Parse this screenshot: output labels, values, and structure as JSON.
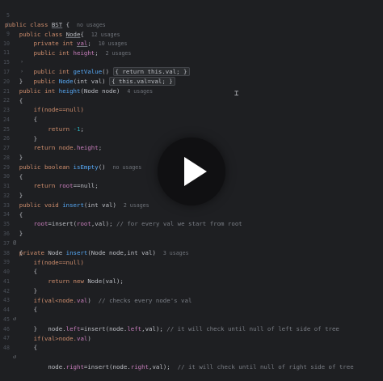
{
  "editor": {
    "hints": {
      "no_usages": "no usages",
      "u12": "12 usages",
      "u10": "10 usages",
      "u2": "2 usages",
      "u4": "4 usages",
      "u3": "3 usages"
    },
    "line_numbers": [
      "5",
      "6",
      "9",
      "10",
      "11",
      "15",
      "17",
      "20",
      "21",
      "22",
      "23",
      "24",
      "25",
      "26",
      "27",
      "28",
      "29",
      "30",
      "31",
      "32",
      "33",
      "34",
      "35",
      "36",
      "37",
      "38",
      "39",
      "40",
      "41",
      "42",
      "43",
      "44",
      "45",
      "46",
      "47",
      "48"
    ],
    "text": {
      "l5_a": "public class ",
      "l5_b": "BST",
      "l5_c": " {",
      "l6_a": "    public class ",
      "l6_b": "Node",
      "l6_c": "{",
      "l9_a": "        private int ",
      "l9_b": "val",
      "l9_c": ";",
      "l10_a": "        public int ",
      "l10_b": "height",
      "l10_c": ";",
      "l11_a": "        public int ",
      "l11_b": "getValue",
      "l11_c": "() ",
      "l11_fold": "{ return this.val; }",
      "l15_a": "        public ",
      "l15_b": "Node",
      "l15_c": "(int val) ",
      "l15_fold": "{ this.val=val; }",
      "l17": "    }",
      "l20_a": "    public int ",
      "l20_b": "height",
      "l20_c": "(Node node)",
      "l21": "    {",
      "l22": "        if(node==null)",
      "l23": "        {",
      "l24_a": "            return ",
      "l24_b": "-1",
      "l24_c": ";",
      "l25": "        }",
      "l26_a": "        return node.",
      "l26_b": "height",
      "l26_c": ";",
      "l27": "    }",
      "l28_a": "    public boolean ",
      "l28_b": "isEmpty",
      "l28_c": "()",
      "l29": "    {",
      "l30_a": "        return ",
      "l30_b": "root",
      "l30_c": "==null;",
      "l31": "    }",
      "l32_a": "    public void ",
      "l32_b": "insert",
      "l32_c": "(int val)",
      "l33": "    {",
      "l34_a": "        ",
      "l34_b": "root",
      "l34_c": "=insert(",
      "l34_d": "root",
      "l34_e": ",val); ",
      "l34_cmt": "// for every val we start from root",
      "l35": "    }",
      "l36_a": "    private ",
      "l36_b": "Node ",
      "l36_c": "insert",
      "l36_d": "(Node node,int val)",
      "l37": "    {",
      "l38": "        if(node==null)",
      "l39": "        {",
      "l40_a": "            return new ",
      "l40_b": "Node(val);",
      "l41": "        }",
      "l42_a": "        if(val<node.",
      "l42_b": "val",
      "l42_c": ")  ",
      "l42_cmt": "// checks every node's val",
      "l43": "        {",
      "l44_a": "            node.",
      "l44_b": "left",
      "l44_c": "=insert(node.",
      "l44_d": "left",
      "l44_e": ",val); ",
      "l44_cmt": "// it will check until null of left side of tree",
      "l45": "        }",
      "l46_a": "        if(val>node.",
      "l46_b": "val",
      "l46_c": ")",
      "l47": "        {",
      "l48_a": "            node.",
      "l48_b": "right",
      "l48_c": "=insert(node.",
      "l48_d": "right",
      "l48_e": ",val);  ",
      "l48_cmt": "// it will check until null of right side of tree"
    }
  },
  "overlay": {
    "play_icon": "play-icon"
  },
  "colors": {
    "background": "#1e1f22",
    "keyword": "#cf8e6d",
    "function": "#56a8f5",
    "field": "#c77dbb",
    "number": "#2aacb8",
    "comment": "#7a7e85"
  }
}
